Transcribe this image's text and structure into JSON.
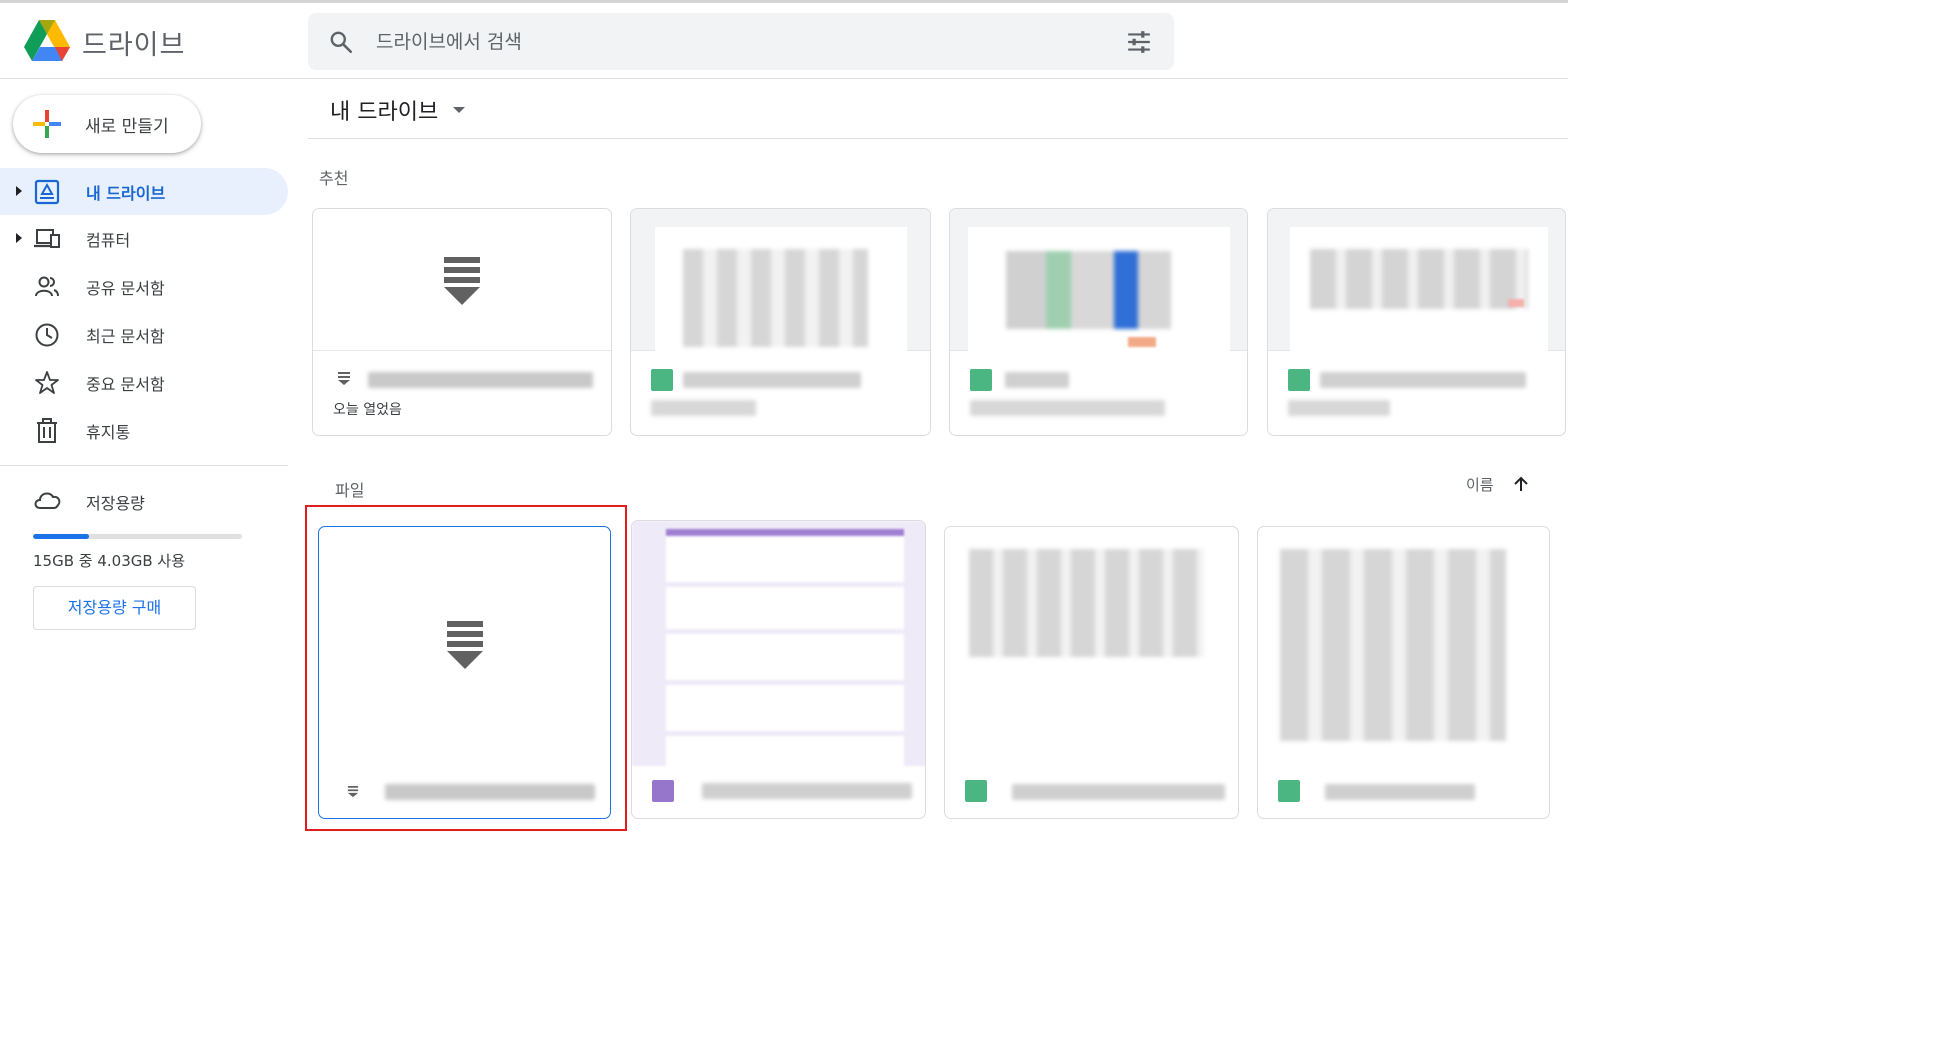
{
  "header": {
    "app_title": "드라이브",
    "search_placeholder": "드라이브에서 검색",
    "icons": [
      "drive-logo",
      "search-icon",
      "tune-icon"
    ]
  },
  "sidebar": {
    "new_button_label": "새로 만들기",
    "items": [
      {
        "label": "내 드라이브",
        "icon": "my-drive-icon",
        "active": true,
        "expandable": true
      },
      {
        "label": "컴퓨터",
        "icon": "computers-icon",
        "active": false,
        "expandable": true
      },
      {
        "label": "공유 문서함",
        "icon": "shared-icon",
        "active": false,
        "expandable": false
      },
      {
        "label": "최근 문서함",
        "icon": "clock-icon",
        "active": false,
        "expandable": false
      },
      {
        "label": "중요 문서함",
        "icon": "star-icon",
        "active": false,
        "expandable": false
      },
      {
        "label": "휴지통",
        "icon": "trash-icon",
        "active": false,
        "expandable": false
      }
    ],
    "storage": {
      "label": "저장용량",
      "usage_text": "15GB 중 4.03GB 사용",
      "used_fraction": 0.27,
      "buy_label": "저장용량 구매"
    }
  },
  "main": {
    "breadcrumb": "내 드라이브",
    "suggested": {
      "title": "추천",
      "cards": [
        {
          "type": "generic-file",
          "subtitle": "오늘 열었음"
        },
        {
          "type": "sheet"
        },
        {
          "type": "sheet"
        },
        {
          "type": "sheet"
        }
      ]
    },
    "files": {
      "title": "파일",
      "sort_label": "이름",
      "cards": [
        {
          "type": "generic-file",
          "selected": true
        },
        {
          "type": "form"
        },
        {
          "type": "sheet"
        },
        {
          "type": "sheet"
        }
      ]
    }
  },
  "colors": {
    "accent": "#1a73e8",
    "active_nav_bg": "#e8f0fe",
    "sheet_green": "#0f9d58",
    "form_purple": "#7248b9",
    "highlight_red": "#e01e1e"
  }
}
